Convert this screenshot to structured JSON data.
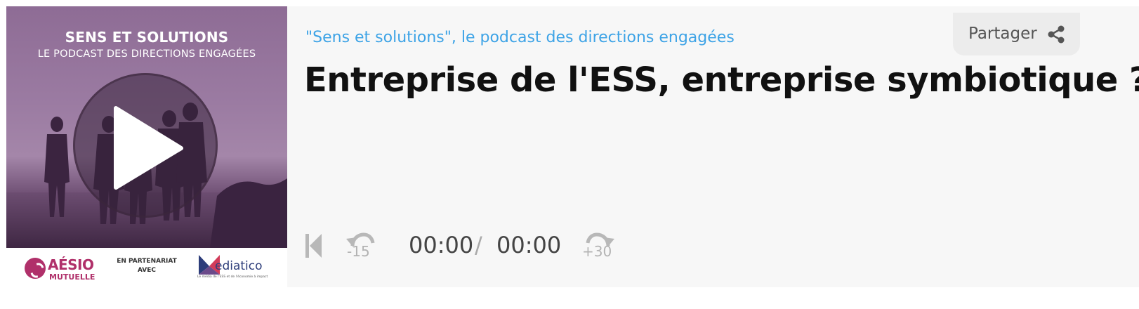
{
  "cover": {
    "title": "SENS ET SOLUTIONS",
    "subtitle": "LE PODCAST DES DIRECTIONS ENGAGÉES",
    "play_icon": "play-icon",
    "sponsors": {
      "aesio_name": "AÉSIO",
      "aesio_sub": "MUTUELLE",
      "partner_line1": "EN PARTENARIAT",
      "partner_line2": "AVEC",
      "mediatico_first": "M",
      "mediatico_rest": "ediatico",
      "mediatico_tagline": "Le média de l'ESS et de l'économie à impact"
    }
  },
  "header": {
    "series": "\"Sens et solutions\", le podcast des directions engagées",
    "episode_title": "Entreprise de l'ESS, entreprise symbiotique ?"
  },
  "share": {
    "label": "Partager",
    "icon": "share-icon"
  },
  "controls": {
    "skip_back_icon": "skip-back-icon",
    "rewind_label": "-15",
    "forward_label": "+30",
    "current_time": "00:00",
    "separator": "/",
    "total_time": "00:00"
  },
  "colors": {
    "accent": "#3da3e6",
    "background": "#f7f7f7",
    "brand_aesio": "#b0306a",
    "brand_mediatico": "#2d3d7a"
  }
}
